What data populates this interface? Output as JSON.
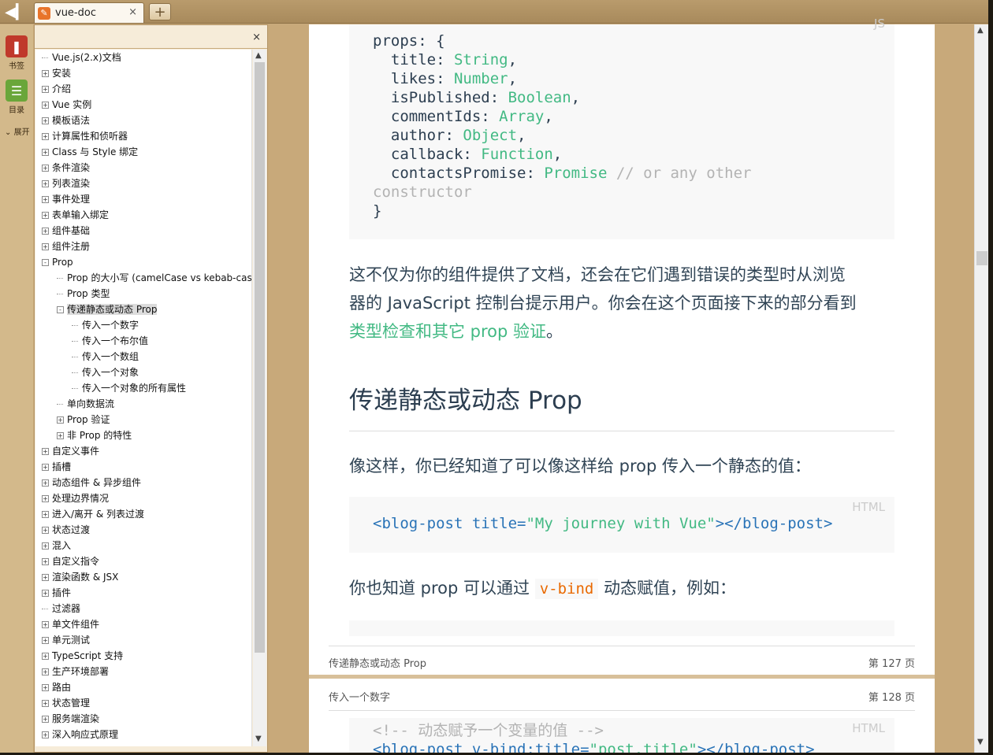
{
  "tabbar": {
    "back_icon": "back-icon",
    "tab_title": "vue-doc",
    "close": "×",
    "new_tab": "+"
  },
  "rail": {
    "bookmark_label": "书签",
    "toc_label": "目录",
    "expand_label": "展开"
  },
  "panel": {
    "close": "×"
  },
  "tree": [
    {
      "label": "Vue.js(2.x)文档",
      "level": 0,
      "toggle": "none"
    },
    {
      "label": "安装",
      "level": 0,
      "toggle": "+"
    },
    {
      "label": "介绍",
      "level": 0,
      "toggle": "+"
    },
    {
      "label": "Vue 实例",
      "level": 0,
      "toggle": "+"
    },
    {
      "label": "模板语法",
      "level": 0,
      "toggle": "+"
    },
    {
      "label": "计算属性和侦听器",
      "level": 0,
      "toggle": "+"
    },
    {
      "label": "Class 与 Style 绑定",
      "level": 0,
      "toggle": "+"
    },
    {
      "label": "条件渲染",
      "level": 0,
      "toggle": "+"
    },
    {
      "label": "列表渲染",
      "level": 0,
      "toggle": "+"
    },
    {
      "label": "事件处理",
      "level": 0,
      "toggle": "+"
    },
    {
      "label": "表单输入绑定",
      "level": 0,
      "toggle": "+"
    },
    {
      "label": "组件基础",
      "level": 0,
      "toggle": "+"
    },
    {
      "label": "组件注册",
      "level": 0,
      "toggle": "+"
    },
    {
      "label": "Prop",
      "level": 0,
      "toggle": "-"
    },
    {
      "label": "Prop 的大小写 (camelCase vs kebab-cas",
      "level": 1,
      "toggle": "none"
    },
    {
      "label": "Prop 类型",
      "level": 1,
      "toggle": "none"
    },
    {
      "label": "传递静态或动态 Prop",
      "level": 1,
      "toggle": "-",
      "selected": true
    },
    {
      "label": "传入一个数字",
      "level": 2,
      "toggle": "none"
    },
    {
      "label": "传入一个布尔值",
      "level": 2,
      "toggle": "none"
    },
    {
      "label": "传入一个数组",
      "level": 2,
      "toggle": "none"
    },
    {
      "label": "传入一个对象",
      "level": 2,
      "toggle": "none"
    },
    {
      "label": "传入一个对象的所有属性",
      "level": 2,
      "toggle": "none"
    },
    {
      "label": "单向数据流",
      "level": 1,
      "toggle": "none"
    },
    {
      "label": "Prop 验证",
      "level": 1,
      "toggle": "+"
    },
    {
      "label": "非 Prop 的特性",
      "level": 1,
      "toggle": "+"
    },
    {
      "label": "自定义事件",
      "level": 0,
      "toggle": "+"
    },
    {
      "label": "插槽",
      "level": 0,
      "toggle": "+"
    },
    {
      "label": "动态组件 & 异步组件",
      "level": 0,
      "toggle": "+"
    },
    {
      "label": "处理边界情况",
      "level": 0,
      "toggle": "+"
    },
    {
      "label": "进入/离开 & 列表过渡",
      "level": 0,
      "toggle": "+"
    },
    {
      "label": "状态过渡",
      "level": 0,
      "toggle": "+"
    },
    {
      "label": "混入",
      "level": 0,
      "toggle": "+"
    },
    {
      "label": "自定义指令",
      "level": 0,
      "toggle": "+"
    },
    {
      "label": "渲染函数 & JSX",
      "level": 0,
      "toggle": "+"
    },
    {
      "label": "插件",
      "level": 0,
      "toggle": "+"
    },
    {
      "label": "过滤器",
      "level": 0,
      "toggle": "none"
    },
    {
      "label": "单文件组件",
      "level": 0,
      "toggle": "+"
    },
    {
      "label": "单元测试",
      "level": 0,
      "toggle": "+"
    },
    {
      "label": "TypeScript 支持",
      "level": 0,
      "toggle": "+"
    },
    {
      "label": "生产环境部署",
      "level": 0,
      "toggle": "+"
    },
    {
      "label": "路由",
      "level": 0,
      "toggle": "+"
    },
    {
      "label": "状态管理",
      "level": 0,
      "toggle": "+"
    },
    {
      "label": "服务端渲染",
      "level": 0,
      "toggle": "+"
    },
    {
      "label": "深入响应式原理",
      "level": 0,
      "toggle": "+"
    }
  ],
  "doc": {
    "code1_lang": "JS",
    "code1_lines": [
      {
        "k": "props: {",
        "v": "",
        "c": ""
      },
      {
        "k": "  title: ",
        "v": "String",
        "c": ","
      },
      {
        "k": "  likes: ",
        "v": "Number",
        "c": ","
      },
      {
        "k": "  isPublished: ",
        "v": "Boolean",
        "c": ","
      },
      {
        "k": "  commentIds: ",
        "v": "Array",
        "c": ","
      },
      {
        "k": "  author: ",
        "v": "Object",
        "c": ","
      },
      {
        "k": "  callback: ",
        "v": "Function",
        "c": ","
      },
      {
        "k": "  contactsPromise: ",
        "v": "Promise",
        "c": ""
      }
    ],
    "code1_comment": " // or any other",
    "code1_comment2": "constructor",
    "code1_close": "}",
    "para1_line1": "这不仅为你的组件提供了文档，还会在它们遇到错误的类型时从浏览",
    "para1_line2": "器的 JavaScript 控制台提示用户。你会在这个页面接下来的部分看到",
    "para1_link": "类型检查和其它 prop 验证",
    "para1_end": "。",
    "heading": "传递静态或动态 Prop",
    "para2": "像这样，你已经知道了可以像这样给 prop 传入一个静态的值：",
    "code2_lang": "HTML",
    "code2_tag_open": "<blog-post ",
    "code2_attr": "title=",
    "code2_val": "\"My journey with Vue\"",
    "code2_tag_close": "></blog-post>",
    "para3_a": "你也知道 prop 可以通过 ",
    "para3_code": "v-bind",
    "para3_b": " 动态赋值，例如：",
    "footer_title": "传递静态或动态 Prop",
    "footer_page": "第 127 页",
    "page2_title": "传入一个数字",
    "page2_page": "第 128 页",
    "code3_lang": "HTML",
    "code3_comment": "<!-- 动态赋予一个变量的值 -->",
    "code3_line2_tag": "<blog-post v-bind:title=",
    "code3_line2_val": "\"post.title\"",
    "code3_line2_close": "></blog-post>"
  }
}
